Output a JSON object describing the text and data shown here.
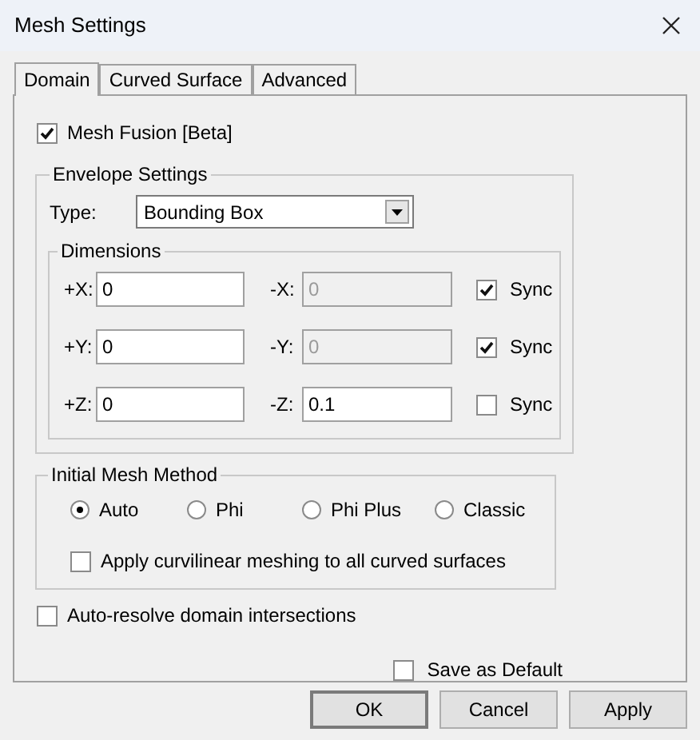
{
  "window": {
    "title": "Mesh Settings"
  },
  "tabs": [
    {
      "label": "Domain",
      "selected": true
    },
    {
      "label": "Curved Surface",
      "selected": false
    },
    {
      "label": "Advanced",
      "selected": false
    }
  ],
  "mesh_fusion": {
    "label": "Mesh Fusion [Beta]",
    "checked": true
  },
  "envelope": {
    "title": "Envelope Settings",
    "type_label": "Type:",
    "type_value": "Bounding Box",
    "dimensions": {
      "title": "Dimensions",
      "rows": [
        {
          "plus_label": "+X:",
          "plus_value": "0",
          "minus_label": "-X:",
          "minus_value": "0",
          "minus_disabled": true,
          "sync_label": "Sync",
          "sync_checked": true
        },
        {
          "plus_label": "+Y:",
          "plus_value": "0",
          "minus_label": "-Y:",
          "minus_value": "0",
          "minus_disabled": true,
          "sync_label": "Sync",
          "sync_checked": true
        },
        {
          "plus_label": "+Z:",
          "plus_value": "0",
          "minus_label": "-Z:",
          "minus_value": "0.1",
          "minus_disabled": false,
          "sync_label": "Sync",
          "sync_checked": false
        }
      ]
    }
  },
  "initial_mesh": {
    "title": "Initial Mesh Method",
    "options": [
      {
        "label": "Auto",
        "selected": true
      },
      {
        "label": "Phi",
        "selected": false
      },
      {
        "label": "Phi Plus",
        "selected": false
      },
      {
        "label": "Classic",
        "selected": false
      }
    ],
    "curvilinear": {
      "label": "Apply curvilinear meshing to all curved surfaces",
      "checked": false
    }
  },
  "auto_resolve": {
    "label": "Auto-resolve domain intersections",
    "checked": false
  },
  "save_default": {
    "label": "Save as Default",
    "checked": false
  },
  "buttons": [
    {
      "label": "OK",
      "default": true
    },
    {
      "label": "Cancel",
      "default": false
    },
    {
      "label": "Apply",
      "default": false
    }
  ]
}
